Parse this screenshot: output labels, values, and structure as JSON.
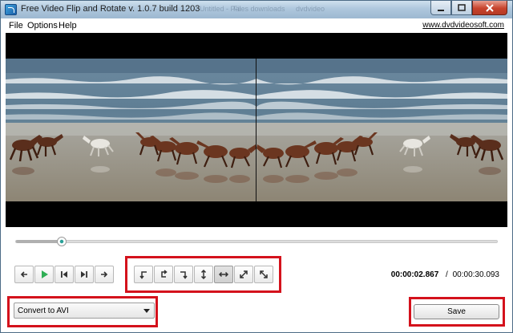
{
  "window": {
    "title": "Free Video Flip and Rotate v. 1.0.7 build 1203",
    "background_hints": [
      "Untitled - Pai",
      "Files downloads",
      "dvdvideo"
    ]
  },
  "menu": {
    "items": [
      "File",
      "Options",
      "Help"
    ],
    "site_link": "www.dvdvideosoft.com"
  },
  "playback": {
    "buttons": [
      "step-back-icon",
      "play-icon",
      "skip-start-icon",
      "skip-end-icon",
      "step-forward-icon"
    ],
    "position_fraction": 0.095
  },
  "transform": {
    "buttons": [
      "rotate-ccw-icon",
      "rotate-180-icon",
      "rotate-cw-icon",
      "flip-vertical-icon",
      "flip-horizontal-icon",
      "transpose-icon",
      "transverse-icon"
    ],
    "active_button": "flip-horizontal-icon"
  },
  "time": {
    "current": "00:00:02.867",
    "separator": "/",
    "total": "00:00:30.093"
  },
  "output": {
    "format": "Convert to AVI",
    "save_label": "Save"
  },
  "colors": {
    "highlight_red": "#d4121c",
    "play_green": "#2fae55",
    "seek_accent": "#2aa198"
  }
}
